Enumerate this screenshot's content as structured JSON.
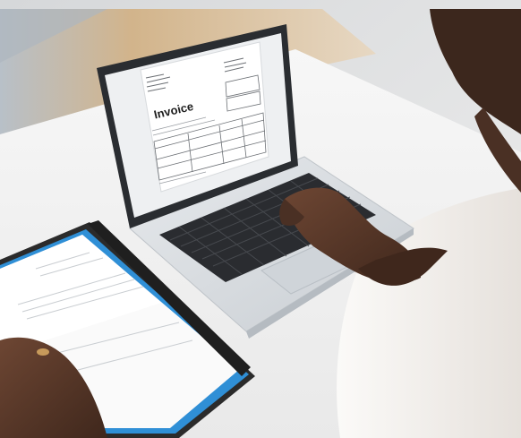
{
  "photo": {
    "screen_document": {
      "heading": "Invoice"
    },
    "colors": {
      "desk": "#f3f3f3",
      "floor": "#c7a77e",
      "laptop_body": "#d9dde1",
      "laptop_bezel": "#2a2d31",
      "screen_page": "#ffffff",
      "skin": "#5a3a2a",
      "shirt": "#f4f1ee",
      "folder": "#2b2b2b",
      "folder_accent": "#2f8fd6"
    }
  }
}
